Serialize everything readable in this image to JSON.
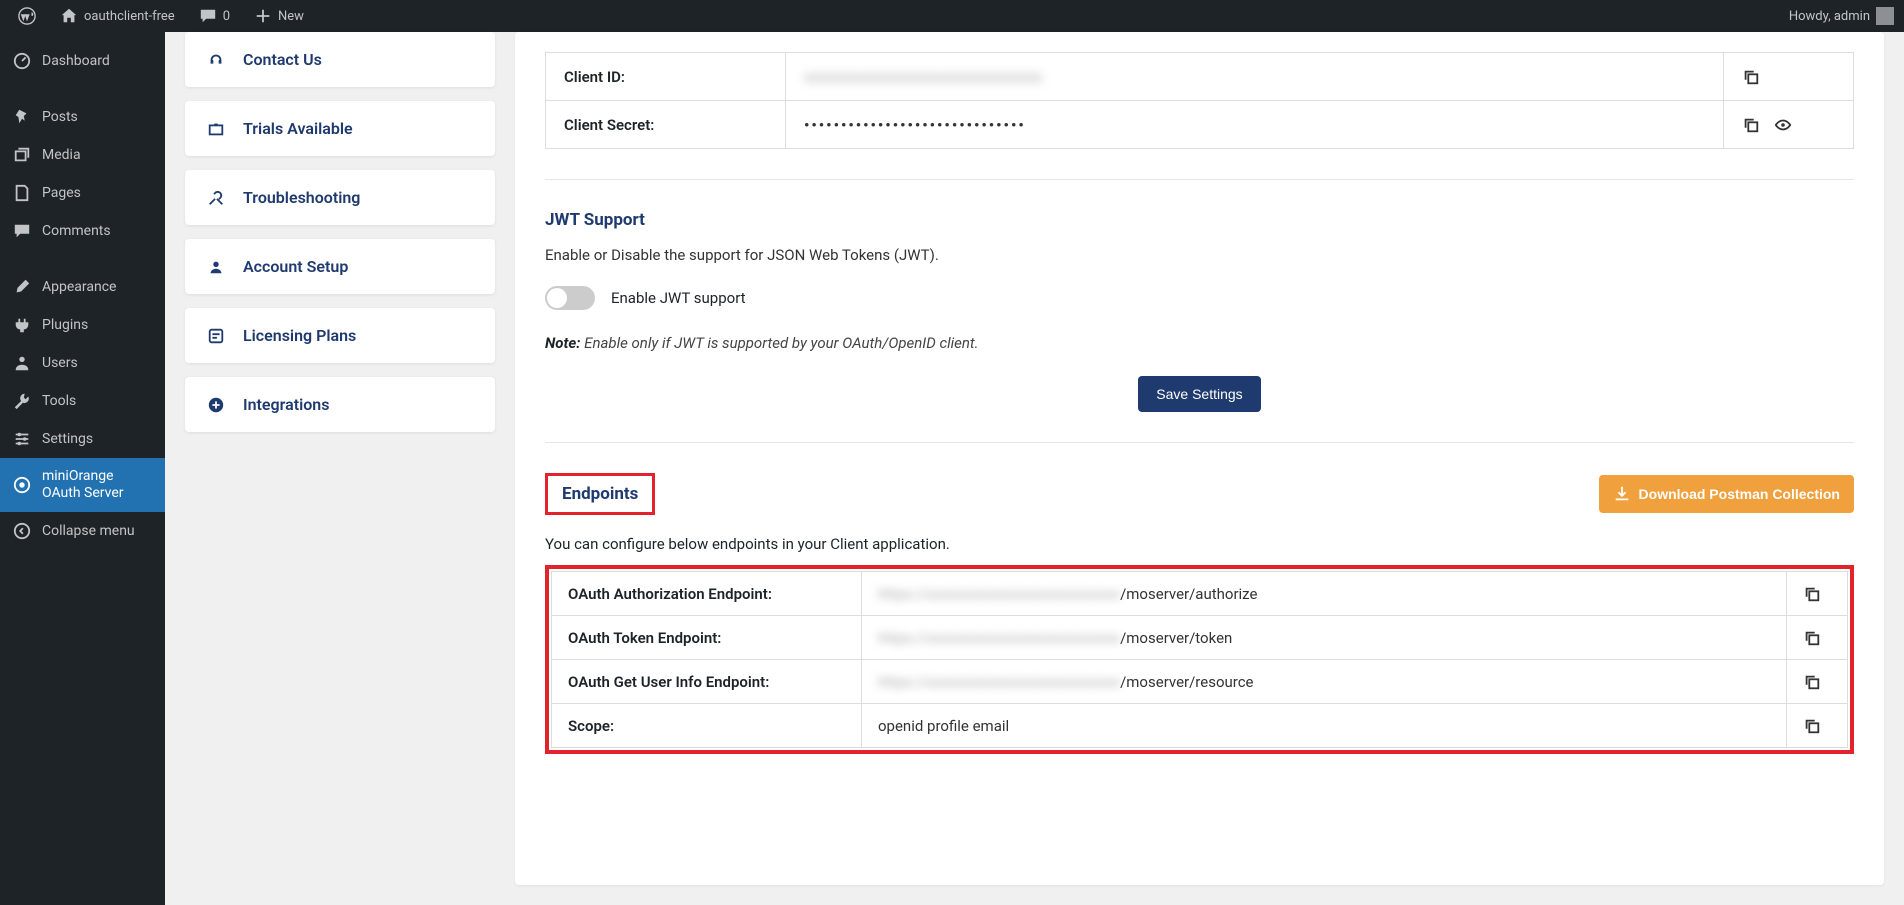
{
  "adminbar": {
    "site_name": "oauthclient-free",
    "comments_count": "0",
    "new_label": "New",
    "howdy": "Howdy, admin"
  },
  "sidebar": {
    "items": [
      {
        "label": "Dashboard"
      },
      {
        "label": "Posts"
      },
      {
        "label": "Media"
      },
      {
        "label": "Pages"
      },
      {
        "label": "Comments"
      },
      {
        "label": "Appearance"
      },
      {
        "label": "Plugins"
      },
      {
        "label": "Users"
      },
      {
        "label": "Tools"
      },
      {
        "label": "Settings"
      },
      {
        "label": "miniOrange OAuth Server"
      },
      {
        "label": "Collapse menu"
      }
    ]
  },
  "inner_nav": {
    "items": [
      {
        "label": "Contact Us"
      },
      {
        "label": "Trials Available"
      },
      {
        "label": "Troubleshooting"
      },
      {
        "label": "Account Setup"
      },
      {
        "label": "Licensing Plans"
      },
      {
        "label": "Integrations"
      }
    ]
  },
  "credentials": {
    "client_id_label": "Client ID:",
    "client_id_value": "xxxxxxxxxxxxxxxxxxxxxxxxxxxxxxxx",
    "client_secret_label": "Client Secret:",
    "client_secret_value": "••••••••••••••••••••••••••••••"
  },
  "jwt": {
    "title": "JWT Support",
    "desc": "Enable or Disable the support for JSON Web Tokens (JWT).",
    "toggle_label": "Enable JWT support",
    "note_prefix": "Note:",
    "note_text": "Enable only if JWT is supported by your OAuth/OpenID client.",
    "save_button": "Save Settings"
  },
  "endpoints": {
    "title": "Endpoints",
    "download_button": "Download Postman Collection",
    "desc": "You can configure below endpoints in your Client application.",
    "rows": [
      {
        "label": "OAuth Authorization Endpoint:",
        "prefix_hidden": "https://xxxxxxxxxxxxxxxxxxxxxxxxxx",
        "suffix": "/moserver/authorize"
      },
      {
        "label": "OAuth Token Endpoint:",
        "prefix_hidden": "https://xxxxxxxxxxxxxxxxxxxxxxxxxx",
        "suffix": "/moserver/token"
      },
      {
        "label": "OAuth Get User Info Endpoint:",
        "prefix_hidden": "https://xxxxxxxxxxxxxxxxxxxxxxxxxx",
        "suffix": "/moserver/resource"
      },
      {
        "label": "Scope:",
        "prefix_hidden": "",
        "suffix": "openid profile email"
      }
    ]
  }
}
